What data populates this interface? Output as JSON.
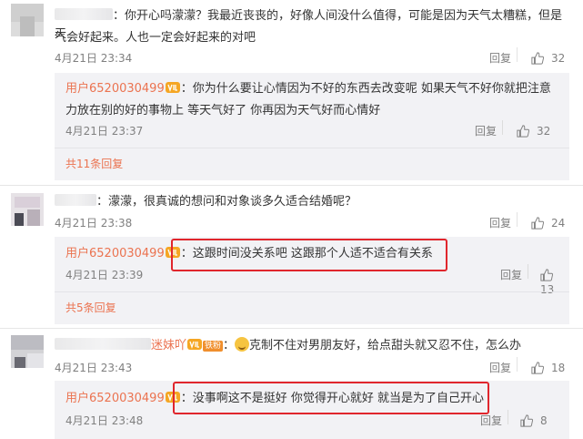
{
  "comments": [
    {
      "text": "：你开心吗濛濛？我最近丧丧的，好像人间没什么值得，可能是因为天气太糟糕，但是天气会好起来。人也一定会好起来的对吧",
      "text_line1": "：你开心吗濛濛？我最近丧丧的，好像人间没什么值得，可能是因为天气太糟糕，但是天",
      "text_line2": "气会好起来。人也一定会好起来的对吧",
      "time": "4月21日 23:34",
      "reply_label": "回复",
      "likes": "32",
      "reply": {
        "user": "用户6520030499",
        "text_line1": "：你为什么要让心情因为不好的东西去改变呢 如果天气不好你就把注意",
        "text_line2": "力放在别的好的事物上 等天气好了 你再因为天气好而心情好",
        "time": "4月21日 23:37",
        "reply_label": "回复",
        "likes": "32"
      },
      "more": "共11条回复"
    },
    {
      "text": "：濛濛，很真诚的想问和对象谈多久适合结婚呢？",
      "time": "4月21日 23:38",
      "reply_label": "回复",
      "likes": "24",
      "reply": {
        "user": "用户6520030499",
        "text": "：这跟时间没关系吧 这跟那个人适不适合有关系",
        "time": "4月21日 23:39",
        "reply_label": "回复",
        "likes": "13"
      },
      "more": "共5条回复"
    },
    {
      "name_tail": "迷妹吖",
      "fans_badge": "铁粉",
      "text": "克制不住对男朋友好，给点甜头就又忍不住，怎么办",
      "time": "4月21日 23:43",
      "reply_label": "回复",
      "likes": "18",
      "reply": {
        "user": "用户6520030499",
        "text": "：没事啊这不是挺好 你觉得开心就好 就当是为了自己开心",
        "time": "4月21日 23:48",
        "reply_label": "回复",
        "likes": "8"
      }
    }
  ],
  "colors": {
    "accent": "#eb7350",
    "highlight": "#e0262d",
    "reply_bg": "#f2f2f5"
  },
  "icons": [
    "thumbs-up-icon",
    "vip-badge-icon",
    "crying-emoji-icon"
  ]
}
